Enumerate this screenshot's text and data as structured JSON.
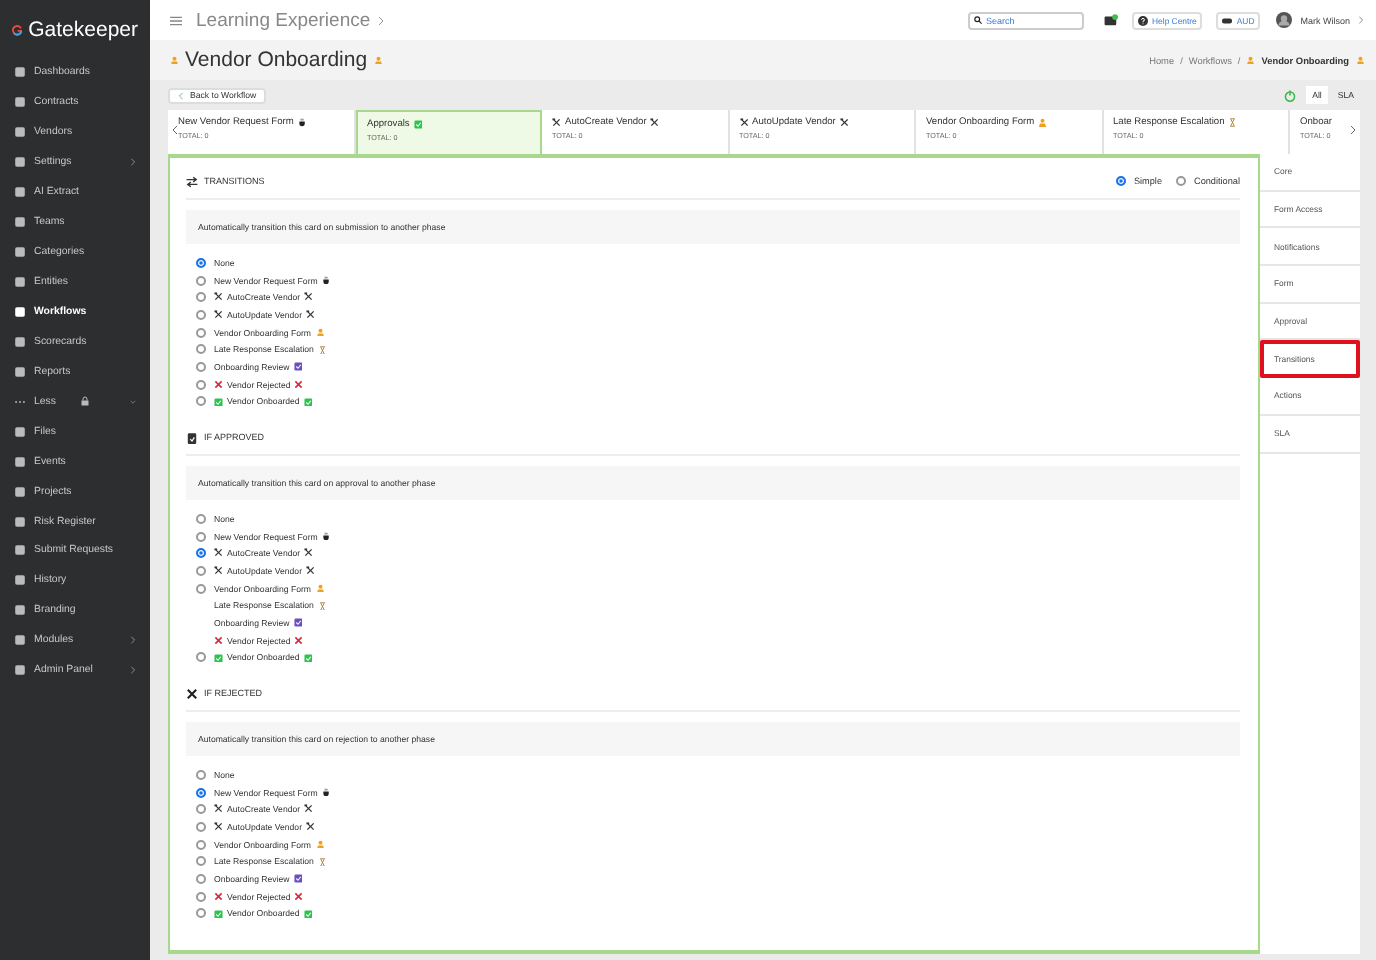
{
  "sidebar": {
    "brand": "Gatekeeper",
    "items": [
      {
        "label": "Dashboards",
        "selected": false,
        "submenu": false,
        "kind": "link"
      },
      {
        "label": "Contracts",
        "selected": false,
        "submenu": false,
        "kind": "link"
      },
      {
        "label": "Vendors",
        "selected": false,
        "submenu": false,
        "kind": "link"
      },
      {
        "label": "Settings",
        "selected": false,
        "submenu": true,
        "kind": "link"
      },
      {
        "label": "AI Extract",
        "selected": false,
        "submenu": false,
        "kind": "link"
      },
      {
        "label": "Teams",
        "selected": false,
        "submenu": false,
        "kind": "link"
      },
      {
        "label": "Categories",
        "selected": false,
        "submenu": false,
        "kind": "link"
      },
      {
        "label": "Entities",
        "selected": false,
        "submenu": false,
        "kind": "link"
      },
      {
        "label": "Workflows",
        "selected": true,
        "submenu": false,
        "kind": "link"
      },
      {
        "label": "Scorecards",
        "selected": false,
        "submenu": false,
        "kind": "link"
      },
      {
        "label": "Reports",
        "selected": false,
        "submenu": false,
        "kind": "link"
      },
      {
        "label": "Less",
        "selected": false,
        "kind": "toggle"
      },
      {
        "label": "Files",
        "selected": false,
        "submenu": false,
        "kind": "link"
      },
      {
        "label": "Events",
        "selected": false,
        "submenu": false,
        "kind": "link"
      },
      {
        "label": "Projects",
        "selected": false,
        "submenu": false,
        "kind": "link"
      },
      {
        "label": "Risk Register",
        "selected": false,
        "submenu": false,
        "kind": "link"
      },
      {
        "label": "Submit Requests",
        "selected": false,
        "submenu": false,
        "kind": "link"
      },
      {
        "label": "History",
        "selected": false,
        "submenu": false,
        "kind": "link"
      },
      {
        "label": "Branding",
        "selected": false,
        "submenu": false,
        "kind": "link"
      },
      {
        "label": "Modules",
        "selected": false,
        "submenu": true,
        "kind": "link"
      },
      {
        "label": "Admin Panel",
        "selected": false,
        "submenu": true,
        "kind": "link"
      }
    ]
  },
  "topbar": {
    "title": "Learning Experience",
    "search": {
      "placeholder": "Search"
    },
    "help": "Help Centre",
    "currency": "AUD",
    "user": "Mark Wilson"
  },
  "header": {
    "title": "Vendor Onboarding",
    "breadcrumb": [
      {
        "label": "Home",
        "separator": "/"
      },
      {
        "label": "Workflows",
        "separator": "/"
      }
    ],
    "breadcrumb_current": "Vendor Onboarding"
  },
  "back_button": "Back to Workflow",
  "view_toggle": [
    {
      "label": "All",
      "selected": true
    },
    {
      "label": "SLA",
      "selected": false
    }
  ],
  "phase_tabs": [
    {
      "label": "New Vendor Request Form",
      "kind": "intake",
      "total": "TOTAL: 0",
      "selected": false
    },
    {
      "label": "Approvals",
      "kind": "approval",
      "total": "TOTAL: 0",
      "selected": true
    },
    {
      "label": "AutoCreate Vendor",
      "kind": "automation",
      "total": "TOTAL: 0",
      "selected": false
    },
    {
      "label": "AutoUpdate Vendor",
      "kind": "automation",
      "total": "TOTAL: 0",
      "selected": false
    },
    {
      "label": "Vendor Onboarding Form",
      "kind": "form",
      "total": "TOTAL: 0",
      "selected": false
    },
    {
      "label": "Late Response Escalation",
      "kind": "escalation",
      "total": "TOTAL: 0",
      "selected": false
    },
    {
      "label": "Onboar",
      "kind": "plain",
      "total": "TOTAL: 0",
      "selected": false
    }
  ],
  "mode": [
    {
      "label": "Simple",
      "selected": true
    },
    {
      "label": "Conditional",
      "selected": false
    }
  ],
  "sections": [
    {
      "title": "TRANSITIONS",
      "kind": "submission",
      "description": "Automatically transition this card on submission to another phase",
      "options": [
        {
          "label": "None",
          "kind": "plain",
          "available": true,
          "selected": true
        },
        {
          "label": "New Vendor Request Form",
          "kind": "intake",
          "available": true,
          "selected": false
        },
        {
          "label": "AutoCreate Vendor",
          "kind": "automation",
          "available": true,
          "selected": false
        },
        {
          "label": "AutoUpdate Vendor",
          "kind": "automation",
          "available": true,
          "selected": false
        },
        {
          "label": "Vendor Onboarding Form",
          "kind": "form",
          "available": true,
          "selected": false
        },
        {
          "label": "Late Response Escalation",
          "kind": "escalation",
          "available": true,
          "selected": false
        },
        {
          "label": "Onboarding Review",
          "kind": "review",
          "available": true,
          "selected": false
        },
        {
          "label": "Vendor Rejected",
          "kind": "rejected",
          "available": true,
          "selected": false
        },
        {
          "label": "Vendor Onboarded",
          "kind": "onboarded",
          "available": true,
          "selected": false
        }
      ]
    },
    {
      "title": "IF APPROVED",
      "kind": "approved",
      "description": "Automatically transition this card on approval to another phase",
      "options": [
        {
          "label": "None",
          "kind": "plain",
          "available": true,
          "selected": false
        },
        {
          "label": "New Vendor Request Form",
          "kind": "intake",
          "available": true,
          "selected": false
        },
        {
          "label": "AutoCreate Vendor",
          "kind": "automation",
          "available": true,
          "selected": true
        },
        {
          "label": "AutoUpdate Vendor",
          "kind": "automation",
          "available": true,
          "selected": false
        },
        {
          "label": "Vendor Onboarding Form",
          "kind": "form",
          "available": true,
          "selected": false
        },
        {
          "label": "Late Response Escalation",
          "kind": "escalation",
          "available": false
        },
        {
          "label": "Onboarding Review",
          "kind": "review",
          "available": false
        },
        {
          "label": "Vendor Rejected",
          "kind": "rejected",
          "available": false
        },
        {
          "label": "Vendor Onboarded",
          "kind": "onboarded",
          "available": true,
          "selected": false
        }
      ]
    },
    {
      "title": "IF REJECTED",
      "kind": "rejection",
      "description": "Automatically transition this card on rejection to another phase",
      "options": [
        {
          "label": "None",
          "kind": "plain",
          "available": true,
          "selected": false
        },
        {
          "label": "New Vendor Request Form",
          "kind": "intake",
          "available": true,
          "selected": true
        },
        {
          "label": "AutoCreate Vendor",
          "kind": "automation",
          "available": true,
          "selected": false
        },
        {
          "label": "AutoUpdate Vendor",
          "kind": "automation",
          "available": true,
          "selected": false
        },
        {
          "label": "Vendor Onboarding Form",
          "kind": "form",
          "available": true,
          "selected": false
        },
        {
          "label": "Late Response Escalation",
          "kind": "escalation",
          "available": true,
          "selected": false
        },
        {
          "label": "Onboarding Review",
          "kind": "review",
          "available": true,
          "selected": false
        },
        {
          "label": "Vendor Rejected",
          "kind": "rejected",
          "available": true,
          "selected": false
        },
        {
          "label": "Vendor Onboarded",
          "kind": "onboarded",
          "available": true,
          "selected": false
        }
      ]
    }
  ],
  "settings_menu": [
    {
      "label": "Core",
      "selected": false
    },
    {
      "label": "Form Access",
      "selected": false
    },
    {
      "label": "Notifications",
      "selected": false
    },
    {
      "label": "Form",
      "selected": false
    },
    {
      "label": "Approval",
      "selected": false
    },
    {
      "label": "Transitions",
      "selected": true
    },
    {
      "label": "Actions",
      "selected": false
    },
    {
      "label": "SLA",
      "selected": false
    }
  ]
}
